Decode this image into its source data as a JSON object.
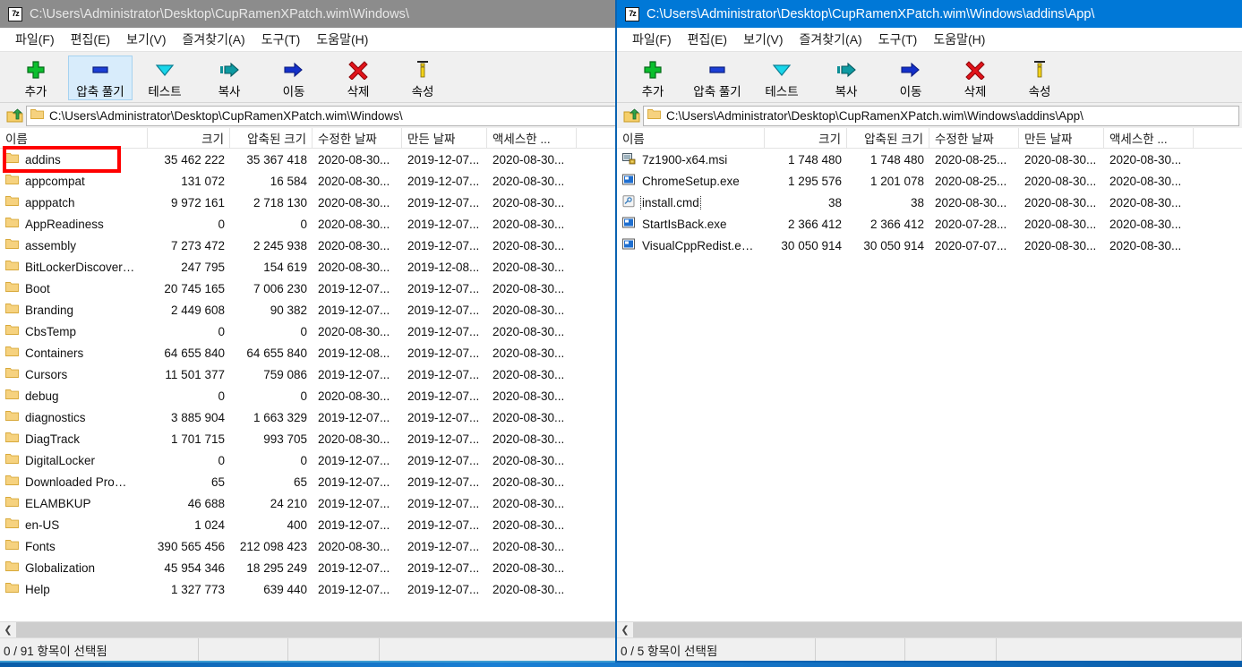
{
  "left_window": {
    "title": "C:\\Users\\Administrator\\Desktop\\CupRamenXPatch.wim\\Windows\\",
    "app_icon_text": "7z",
    "active": false,
    "menu": [
      {
        "label": "파일(F)"
      },
      {
        "label": "편집(E)"
      },
      {
        "label": "보기(V)"
      },
      {
        "label": "즐겨찾기(A)"
      },
      {
        "label": "도구(T)"
      },
      {
        "label": "도움말(H)"
      }
    ],
    "toolbar": [
      {
        "label": "추가",
        "icon": "add-plus-icon",
        "hot": false
      },
      {
        "label": "압축 풀기",
        "icon": "extract-icon",
        "hot": true
      },
      {
        "label": "테스트",
        "icon": "test-chevron-down-icon",
        "hot": false
      },
      {
        "label": "복사",
        "icon": "copy-arrow-icon",
        "hot": false
      },
      {
        "label": "이동",
        "icon": "move-arrow-icon",
        "hot": false
      },
      {
        "label": "삭제",
        "icon": "delete-x-icon",
        "hot": false
      },
      {
        "label": "속성",
        "icon": "info-properties-icon",
        "hot": false
      }
    ],
    "address": "C:\\Users\\Administrator\\Desktop\\CupRamenXPatch.wim\\Windows\\",
    "columns": [
      "이름",
      "크기",
      "압축된 크기",
      "수정한 날짜",
      "만든 날짜",
      "액세스한 ..."
    ],
    "rows": [
      {
        "name": "addins",
        "size": "35 462 222",
        "packed": "35 367 418",
        "modified": "2020-08-30...",
        "created": "2019-12-07...",
        "accessed": "2020-08-30...",
        "kind": "folder",
        "annotated": true
      },
      {
        "name": "appcompat",
        "size": "131 072",
        "packed": "16 584",
        "modified": "2020-08-30...",
        "created": "2019-12-07...",
        "accessed": "2020-08-30...",
        "kind": "folder"
      },
      {
        "name": "apppatch",
        "size": "9 972 161",
        "packed": "2 718 130",
        "modified": "2020-08-30...",
        "created": "2019-12-07...",
        "accessed": "2020-08-30...",
        "kind": "folder"
      },
      {
        "name": "AppReadiness",
        "size": "0",
        "packed": "0",
        "modified": "2020-08-30...",
        "created": "2019-12-07...",
        "accessed": "2020-08-30...",
        "kind": "folder"
      },
      {
        "name": "assembly",
        "size": "7 273 472",
        "packed": "2 245 938",
        "modified": "2020-08-30...",
        "created": "2019-12-07...",
        "accessed": "2020-08-30...",
        "kind": "folder"
      },
      {
        "name": "BitLockerDiscover…",
        "size": "247 795",
        "packed": "154 619",
        "modified": "2020-08-30...",
        "created": "2019-12-08...",
        "accessed": "2020-08-30...",
        "kind": "folder"
      },
      {
        "name": "Boot",
        "size": "20 745 165",
        "packed": "7 006 230",
        "modified": "2019-12-07...",
        "created": "2019-12-07...",
        "accessed": "2020-08-30...",
        "kind": "folder"
      },
      {
        "name": "Branding",
        "size": "2 449 608",
        "packed": "90 382",
        "modified": "2019-12-07...",
        "created": "2019-12-07...",
        "accessed": "2020-08-30...",
        "kind": "folder"
      },
      {
        "name": "CbsTemp",
        "size": "0",
        "packed": "0",
        "modified": "2020-08-30...",
        "created": "2019-12-07...",
        "accessed": "2020-08-30...",
        "kind": "folder"
      },
      {
        "name": "Containers",
        "size": "64 655 840",
        "packed": "64 655 840",
        "modified": "2019-12-08...",
        "created": "2019-12-07...",
        "accessed": "2020-08-30...",
        "kind": "folder"
      },
      {
        "name": "Cursors",
        "size": "11 501 377",
        "packed": "759 086",
        "modified": "2019-12-07...",
        "created": "2019-12-07...",
        "accessed": "2020-08-30...",
        "kind": "folder"
      },
      {
        "name": "debug",
        "size": "0",
        "packed": "0",
        "modified": "2020-08-30...",
        "created": "2019-12-07...",
        "accessed": "2020-08-30...",
        "kind": "folder"
      },
      {
        "name": "diagnostics",
        "size": "3 885 904",
        "packed": "1 663 329",
        "modified": "2019-12-07...",
        "created": "2019-12-07...",
        "accessed": "2020-08-30...",
        "kind": "folder"
      },
      {
        "name": "DiagTrack",
        "size": "1 701 715",
        "packed": "993 705",
        "modified": "2020-08-30...",
        "created": "2019-12-07...",
        "accessed": "2020-08-30...",
        "kind": "folder"
      },
      {
        "name": "DigitalLocker",
        "size": "0",
        "packed": "0",
        "modified": "2019-12-07...",
        "created": "2019-12-07...",
        "accessed": "2020-08-30...",
        "kind": "folder"
      },
      {
        "name": "Downloaded Pro…",
        "size": "65",
        "packed": "65",
        "modified": "2019-12-07...",
        "created": "2019-12-07...",
        "accessed": "2020-08-30...",
        "kind": "folder"
      },
      {
        "name": "ELAMBKUP",
        "size": "46 688",
        "packed": "24 210",
        "modified": "2019-12-07...",
        "created": "2019-12-07...",
        "accessed": "2020-08-30...",
        "kind": "folder"
      },
      {
        "name": "en-US",
        "size": "1 024",
        "packed": "400",
        "modified": "2019-12-07...",
        "created": "2019-12-07...",
        "accessed": "2020-08-30...",
        "kind": "folder"
      },
      {
        "name": "Fonts",
        "size": "390 565 456",
        "packed": "212 098 423",
        "modified": "2020-08-30...",
        "created": "2019-12-07...",
        "accessed": "2020-08-30...",
        "kind": "folder"
      },
      {
        "name": "Globalization",
        "size": "45 954 346",
        "packed": "18 295 249",
        "modified": "2019-12-07...",
        "created": "2019-12-07...",
        "accessed": "2020-08-30...",
        "kind": "folder"
      },
      {
        "name": "Help",
        "size": "1 327 773",
        "packed": "639 440",
        "modified": "2019-12-07...",
        "created": "2019-12-07...",
        "accessed": "2020-08-30...",
        "kind": "folder"
      }
    ],
    "status": {
      "selection": "0 / 91 항목이 선택됨",
      "pane2": "",
      "pane3": "",
      "pane4": ""
    }
  },
  "right_window": {
    "title": "C:\\Users\\Administrator\\Desktop\\CupRamenXPatch.wim\\Windows\\addins\\App\\",
    "app_icon_text": "7z",
    "active": true,
    "menu": [
      {
        "label": "파일(F)"
      },
      {
        "label": "편집(E)"
      },
      {
        "label": "보기(V)"
      },
      {
        "label": "즐겨찾기(A)"
      },
      {
        "label": "도구(T)"
      },
      {
        "label": "도움말(H)"
      }
    ],
    "toolbar": [
      {
        "label": "추가",
        "icon": "add-plus-icon",
        "hot": false
      },
      {
        "label": "압축 풀기",
        "icon": "extract-icon",
        "hot": false
      },
      {
        "label": "테스트",
        "icon": "test-chevron-down-icon",
        "hot": false
      },
      {
        "label": "복사",
        "icon": "copy-arrow-icon",
        "hot": false
      },
      {
        "label": "이동",
        "icon": "move-arrow-icon",
        "hot": false
      },
      {
        "label": "삭제",
        "icon": "delete-x-icon",
        "hot": false
      },
      {
        "label": "속성",
        "icon": "info-properties-icon",
        "hot": false
      }
    ],
    "address": "C:\\Users\\Administrator\\Desktop\\CupRamenXPatch.wim\\Windows\\addins\\App\\",
    "columns": [
      "이름",
      "크기",
      "압축된 크기",
      "수정한 날짜",
      "만든 날짜",
      "액세스한 ..."
    ],
    "rows": [
      {
        "name": "7z1900-x64.msi",
        "size": "1 748 480",
        "packed": "1 748 480",
        "modified": "2020-08-25...",
        "created": "2020-08-30...",
        "accessed": "2020-08-30...",
        "kind": "msi"
      },
      {
        "name": "ChromeSetup.exe",
        "size": "1 295 576",
        "packed": "1 201 078",
        "modified": "2020-08-25...",
        "created": "2020-08-30...",
        "accessed": "2020-08-30...",
        "kind": "exe"
      },
      {
        "name": "install.cmd",
        "size": "38",
        "packed": "38",
        "modified": "2020-08-30...",
        "created": "2020-08-30...",
        "accessed": "2020-08-30...",
        "kind": "cmd",
        "focused": true
      },
      {
        "name": "StartIsBack.exe",
        "size": "2 366 412",
        "packed": "2 366 412",
        "modified": "2020-07-28...",
        "created": "2020-08-30...",
        "accessed": "2020-08-30...",
        "kind": "exe"
      },
      {
        "name": "VisualCppRedist.e…",
        "size": "30 050 914",
        "packed": "30 050 914",
        "modified": "2020-07-07...",
        "created": "2020-08-30...",
        "accessed": "2020-08-30...",
        "kind": "exe"
      }
    ],
    "status": {
      "selection": "0 / 5 항목이 선택됨",
      "pane2": "",
      "pane3": "",
      "pane4": ""
    }
  },
  "annotation": {
    "color": "#ff0000",
    "target": "addins"
  }
}
